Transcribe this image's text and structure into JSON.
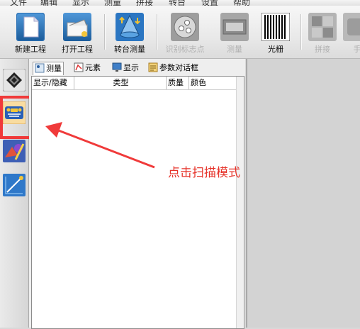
{
  "menu": [
    "文件",
    "编辑",
    "显示",
    "测量",
    "拼接",
    "转台",
    "设置",
    "帮助"
  ],
  "toolbar": {
    "new_project": "新建工程",
    "open_project": "打开工程",
    "turntable_measure": "转台测量",
    "identify_markers": "识别标志点",
    "measure": "测量",
    "grating": "光栅",
    "stitch": "拼接",
    "manual": "手"
  },
  "tabs": [
    "测量",
    "元素",
    "显示",
    "参数对话框"
  ],
  "columns": [
    "显示/隐藏",
    "类型",
    "质量",
    "颜色"
  ],
  "annotation": {
    "text": "点击扫描模式",
    "color": "#e6332a"
  },
  "colors": {
    "annotation_red": "#f03a3a"
  }
}
